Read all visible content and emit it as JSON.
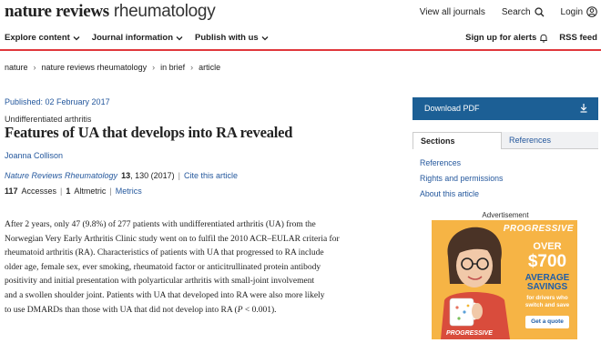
{
  "header": {
    "logo_bold": "nature reviews",
    "logo_light": " rheumatology",
    "view_all": "View all journals",
    "search": "Search",
    "login": "Login"
  },
  "nav": {
    "explore": "Explore content",
    "journal_info": "Journal information",
    "publish": "Publish with us",
    "signup": "Sign up for alerts",
    "rss": "RSS feed"
  },
  "breadcrumb": {
    "items": [
      "nature",
      "nature reviews rheumatology",
      "in brief",
      "article"
    ]
  },
  "article": {
    "published": "Published: 02 February 2017",
    "category": "Undifferentiated arthritis",
    "title": "Features of UA that develops into RA revealed",
    "author": "Joanna Collison",
    "journal": "Nature Reviews Rheumatology",
    "volume": "13",
    "pages": ", 130 (2017)",
    "cite": "Cite this article",
    "accesses_count": "117",
    "accesses_label": "Accesses",
    "altmetric_count": "1",
    "altmetric_label": "Altmetric",
    "metrics": "Metrics",
    "body_lines": [
      "After 2 years, only 47 (9.8%) of 277 patients with undifferentiated arthritis (UA) from the",
      "Norwegian Very Early Arthritis Clinic study went on to fulfil the 2010 ACR–EULAR criteria for",
      "rheumatoid arthritis (RA). Characteristics of patients with UA that progressed to RA include",
      "older age, female sex, ever smoking, rheumatoid factor or anticitrullinated protein antibody",
      "positivity and initial presentation with polyarticular arthritis with small-joint involvement",
      "and a swollen shoulder joint. Patients with UA that developed into RA were also more likely"
    ],
    "body_last_pre": "to use DMARDs than those with UA that did not develop into RA (",
    "body_last_p": "P",
    "body_last_post": " < 0.001)."
  },
  "sidebar": {
    "download": "Download PDF",
    "tab_sections": "Sections",
    "tab_references": "References",
    "links": [
      "References",
      "Rights and permissions",
      "About this article"
    ],
    "ad_label": "Advertisement"
  },
  "ad": {
    "brand": "PROGRESSIVE",
    "over": "OVER",
    "amount": "$700",
    "average": "AVERAGE",
    "savings": "SAVINGS",
    "sub1": "for drivers who",
    "sub2": "switch and save",
    "cta": "Get a quote",
    "bottom_brand": "PROGRESSIVE"
  },
  "colors": {
    "link": "#25589d",
    "accent_red": "#e0373b",
    "button_blue": "#1c5f95",
    "ad_orange": "#f6b445"
  }
}
